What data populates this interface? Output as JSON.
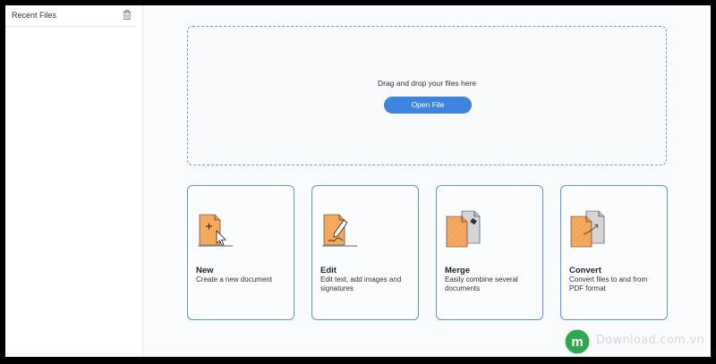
{
  "sidebar": {
    "title": "Recent Files",
    "delete_icon": "trash-icon"
  },
  "drop_zone": {
    "text": "Drag and drop your files here",
    "button_label": "Open File"
  },
  "cards": [
    {
      "title": "New",
      "desc": "Create a new document",
      "icon": "new-document-icon"
    },
    {
      "title": "Edit",
      "desc": "Edit text, add images and signatures",
      "icon": "edit-document-icon"
    },
    {
      "title": "Merge",
      "desc": "Easily combine several documents",
      "icon": "merge-documents-icon"
    },
    {
      "title": "Convert",
      "desc": "Convert files to and from PDF format",
      "icon": "convert-document-icon"
    }
  ],
  "watermark": {
    "text": "Download.com.vn",
    "logo_letter": "m"
  },
  "colors": {
    "accent": "#3f84e0",
    "card_border": "#5b97cf",
    "document_orange": "#f5a95c",
    "document_gray": "#d5d5d5"
  }
}
